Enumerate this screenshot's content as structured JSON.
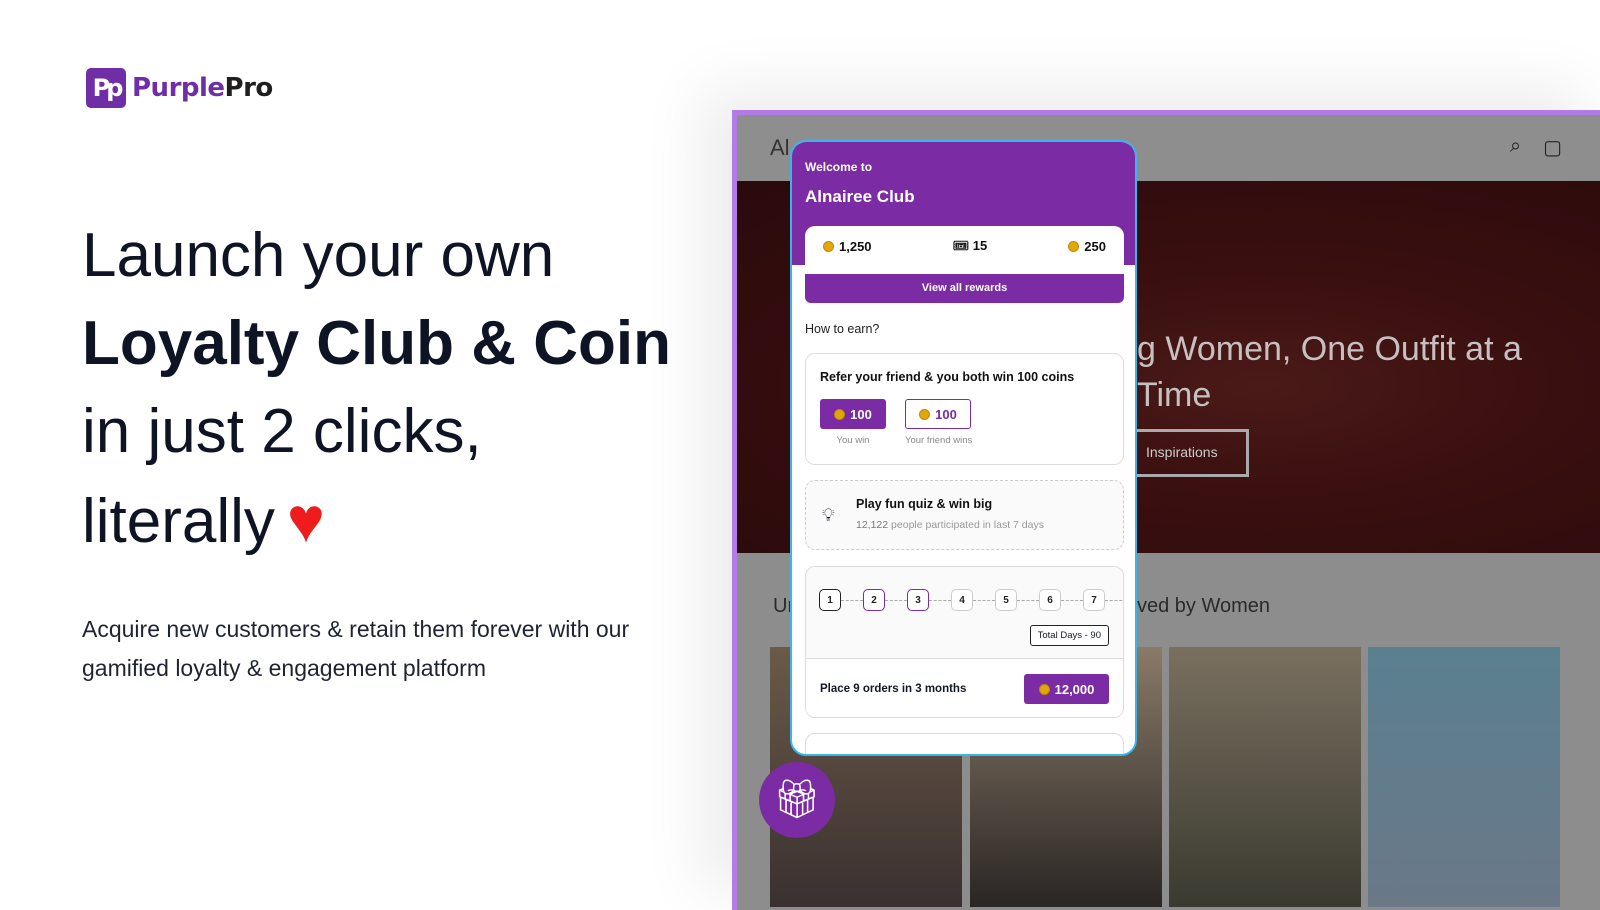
{
  "brand": {
    "logo_mark": "Pp",
    "name_part1": "Purple",
    "name_part2": "Pro"
  },
  "hero": {
    "line1": "Launch your own",
    "line2": "Loyalty Club & Coin",
    "line3": "in just 2 clicks,",
    "line4": "literally",
    "heart_icon": "heart-icon"
  },
  "subtitle": "Acquire new customers & retain them forever with our gamified loyalty & engagement platform",
  "store": {
    "name": "Al",
    "hero_title": "g Women, One Outfit at a Time",
    "hero_button": "Inspirations",
    "section_left": "Ur",
    "section_right": "ved by Women",
    "icons": [
      "search-icon",
      "cart-icon"
    ]
  },
  "widget": {
    "welcome": "Welcome to",
    "club_name": "Alnairee Club",
    "stats": [
      {
        "icon": "coin-icon",
        "value": "1,250"
      },
      {
        "icon": "ticket-icon",
        "value": "15"
      },
      {
        "icon": "coin-icon",
        "value": "250"
      }
    ],
    "view_rewards": "View all rewards",
    "how_to_earn": "How to earn?",
    "refer": {
      "title": "Refer your friend & you both win 100 coins",
      "you_value": "100",
      "you_label": "You win",
      "friend_value": "100",
      "friend_label": "Your friend wins"
    },
    "quiz": {
      "title": "Play fun quiz & win big",
      "count": "12,122",
      "suffix": "people participated in last 7 days"
    },
    "streak": {
      "days": [
        "1",
        "2",
        "3",
        "4",
        "5",
        "6",
        "7"
      ],
      "total": "Total Days - 90",
      "order_text": "Place 9 orders in 3 months",
      "reward": "12,000"
    }
  },
  "colors": {
    "accent": "#7b2ba3",
    "frame": "#b37be6",
    "widget_border": "#3bb4e8",
    "heart": "#ee1c1c",
    "coin": "#e0a80d"
  }
}
